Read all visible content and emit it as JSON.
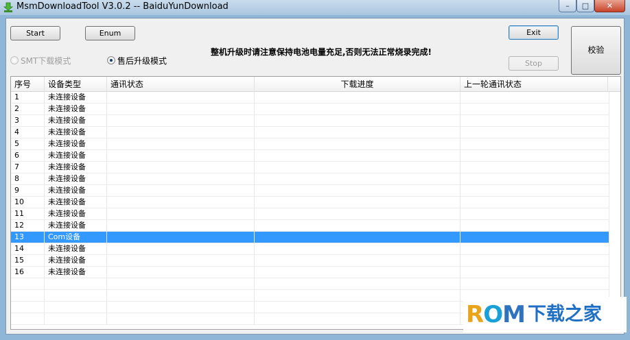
{
  "window": {
    "title": "MsmDownloadTool V3.0.2 -- BaiduYunDownload",
    "minimize_glyph": "–",
    "maximize_glyph": "□",
    "close_glyph": "✕"
  },
  "toolbar": {
    "start_label": "Start",
    "enum_label": "Enum",
    "exit_label": "Exit",
    "stop_label": "Stop",
    "verify_label": "校验"
  },
  "modes": {
    "smt_label": "SMT下载模式",
    "smt_checked": false,
    "smt_enabled": false,
    "after_sales_label": "售后升级模式",
    "after_sales_checked": true
  },
  "notice": "整机升级时请注意保持电池电量充足,否则无法正常烧录完成!",
  "table": {
    "columns": [
      "序号",
      "设备类型",
      "通讯状态",
      "下载进度",
      "上一轮通讯状态"
    ],
    "rows": [
      {
        "index": "1",
        "type": "未连接设备",
        "comm": "",
        "progress": "",
        "last": ""
      },
      {
        "index": "2",
        "type": "未连接设备",
        "comm": "",
        "progress": "",
        "last": ""
      },
      {
        "index": "3",
        "type": "未连接设备",
        "comm": "",
        "progress": "",
        "last": ""
      },
      {
        "index": "4",
        "type": "未连接设备",
        "comm": "",
        "progress": "",
        "last": ""
      },
      {
        "index": "5",
        "type": "未连接设备",
        "comm": "",
        "progress": "",
        "last": ""
      },
      {
        "index": "6",
        "type": "未连接设备",
        "comm": "",
        "progress": "",
        "last": ""
      },
      {
        "index": "7",
        "type": "未连接设备",
        "comm": "",
        "progress": "",
        "last": ""
      },
      {
        "index": "8",
        "type": "未连接设备",
        "comm": "",
        "progress": "",
        "last": ""
      },
      {
        "index": "9",
        "type": "未连接设备",
        "comm": "",
        "progress": "",
        "last": ""
      },
      {
        "index": "10",
        "type": "未连接设备",
        "comm": "",
        "progress": "",
        "last": ""
      },
      {
        "index": "11",
        "type": "未连接设备",
        "comm": "",
        "progress": "",
        "last": ""
      },
      {
        "index": "12",
        "type": "未连接设备",
        "comm": "",
        "progress": "",
        "last": ""
      },
      {
        "index": "13",
        "type": "Com设备",
        "comm": "",
        "progress": "",
        "last": "",
        "selected": true
      },
      {
        "index": "14",
        "type": "未连接设备",
        "comm": "",
        "progress": "",
        "last": ""
      },
      {
        "index": "15",
        "type": "未连接设备",
        "comm": "",
        "progress": "",
        "last": ""
      },
      {
        "index": "16",
        "type": "未连接设备",
        "comm": "",
        "progress": "",
        "last": ""
      }
    ]
  },
  "watermark": {
    "rom_r": "R",
    "rom_o": "O",
    "rom_m": "M",
    "text": "下载之家"
  },
  "colors": {
    "selection": "#3399ff",
    "title_gradient_top": "#c9dcec",
    "close_button": "#c7442b"
  }
}
